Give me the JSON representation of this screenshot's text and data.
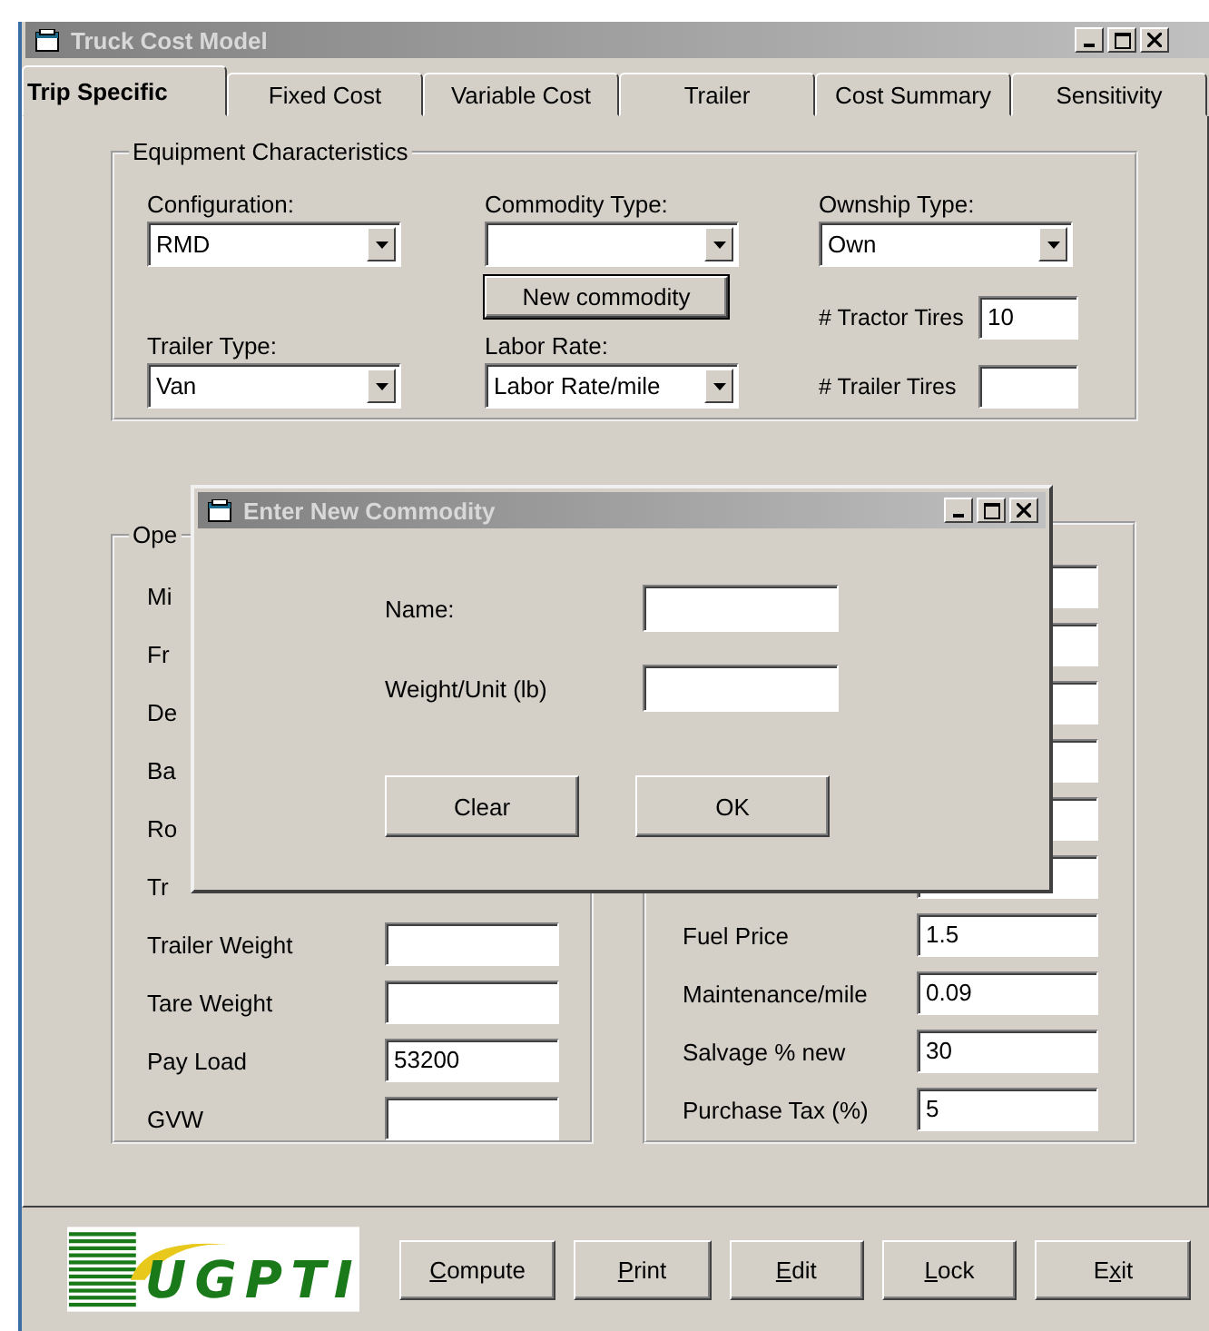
{
  "window": {
    "title": "Truck Cost Model"
  },
  "tabs": [
    {
      "label": "Trip Specific",
      "selected": true
    },
    {
      "label": "Fixed Cost",
      "selected": false
    },
    {
      "label": "Variable Cost",
      "selected": false
    },
    {
      "label": "Trailer",
      "selected": false
    },
    {
      "label": "Cost Summary",
      "selected": false
    },
    {
      "label": "Sensitivity",
      "selected": false
    }
  ],
  "equipment": {
    "title": "Equipment Characteristics",
    "configuration": {
      "label": "Configuration:",
      "value": "RMD"
    },
    "commodity_type": {
      "label": "Commodity Type:"
    },
    "ownship_type": {
      "label": "Ownship Type:",
      "value": "Own"
    },
    "new_commodity_button": "New commodity",
    "trailer_type": {
      "label": "Trailer Type:",
      "value": "Van"
    },
    "labor_rate": {
      "label": "Labor Rate:",
      "value": "Labor Rate/mile"
    },
    "tractor_tires": {
      "label": "# Tractor Tires",
      "value": "10"
    },
    "trailer_tires": {
      "label": "# Trailer Tires"
    }
  },
  "operating": {
    "title": "Ope",
    "left_rows": [
      {
        "kind": "covered",
        "label": "Mi"
      },
      {
        "kind": "covered",
        "label": "Fr"
      },
      {
        "kind": "covered",
        "label": "De"
      },
      {
        "kind": "covered",
        "label": "Ba"
      },
      {
        "kind": "covered",
        "label": "Ro"
      },
      {
        "kind": "covered",
        "label": "Tr"
      },
      {
        "kind": "field",
        "label": "Trailer Weight"
      },
      {
        "kind": "field",
        "label": "Tare Weight"
      },
      {
        "kind": "field",
        "label": "Pay Load",
        "value": "53200"
      },
      {
        "kind": "field",
        "label": "GVW"
      }
    ],
    "right_rows": [
      {},
      {},
      {},
      {},
      {},
      {},
      {
        "label": "Fuel Price",
        "value": "1.5"
      },
      {
        "label": "Maintenance/mile",
        "value": "0.09"
      },
      {
        "label": "Salvage % new",
        "value": "30"
      },
      {
        "label": "Purchase Tax (%)",
        "value": "5"
      }
    ]
  },
  "logo": {
    "text": "UGPTI"
  },
  "buttons": [
    {
      "key": "C",
      "after": "ompute"
    },
    {
      "key": "P",
      "after": "rint"
    },
    {
      "key": "E",
      "after": "dit"
    },
    {
      "key": "L",
      "after": "ock"
    },
    {
      "before": "E",
      "key": "x",
      "after": "it"
    }
  ],
  "dialog": {
    "title": "Enter New Commodity",
    "fields": [
      {
        "label": "Name:"
      },
      {
        "label": "Weight/Unit (lb)"
      }
    ],
    "buttons": [
      "Clear",
      "OK"
    ]
  }
}
